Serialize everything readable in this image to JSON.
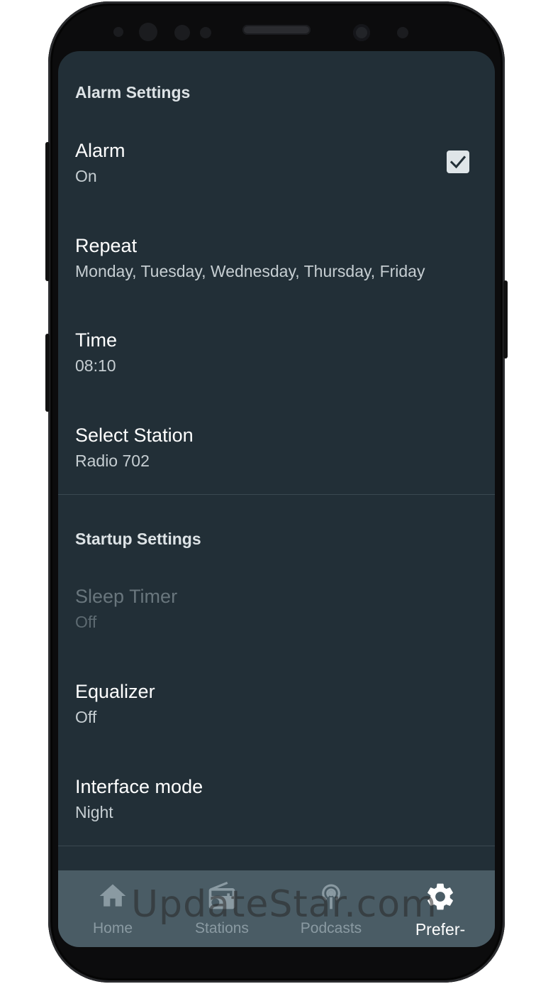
{
  "alarm_section": {
    "header": "Alarm Settings",
    "items": [
      {
        "title": "Alarm",
        "summary": "On",
        "checked": true
      },
      {
        "title": "Repeat",
        "summary": "Monday, Tuesday, Wednesday, Thursday, Friday"
      },
      {
        "title": "Time",
        "summary": "08:10"
      },
      {
        "title": "Select Station",
        "summary": "Radio 702"
      }
    ]
  },
  "startup_section": {
    "header": "Startup Settings",
    "items": [
      {
        "title": "Sleep Timer",
        "summary": "Off",
        "enabled": false
      },
      {
        "title": "Equalizer",
        "summary": "Off"
      },
      {
        "title": "Interface mode",
        "summary": "Night"
      }
    ]
  },
  "bottom_nav": {
    "items": [
      {
        "label": "Home",
        "icon": "home-icon"
      },
      {
        "label": "Stations",
        "icon": "radio-icon"
      },
      {
        "label": "Podcasts",
        "icon": "podcast-icon"
      },
      {
        "label": "Prefer-",
        "icon": "gear-icon",
        "active": true
      }
    ]
  },
  "watermark": "UpdateStar.com",
  "colors": {
    "screen_bg": "#222f37",
    "nav_bg": "#4a5c65",
    "text_primary": "#ffffff",
    "text_secondary": "#c6ced2"
  }
}
